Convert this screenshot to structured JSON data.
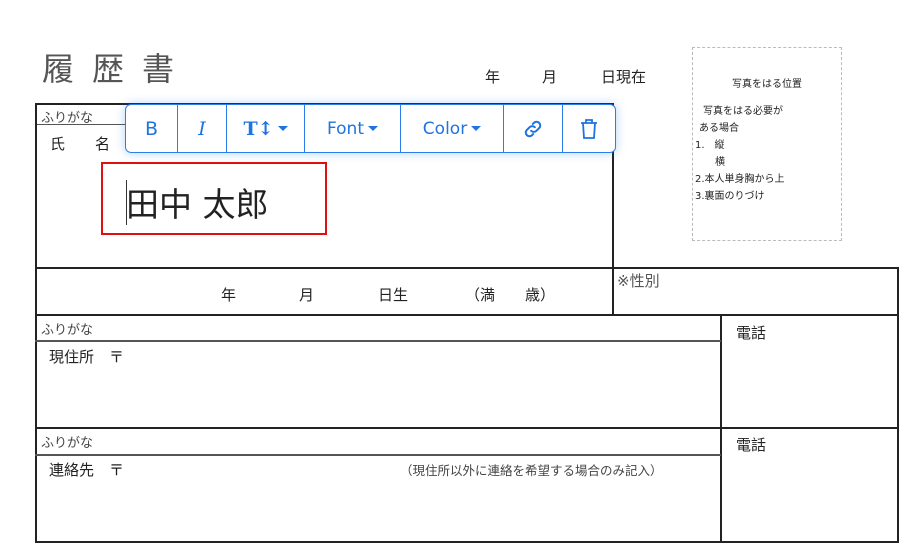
{
  "document": {
    "title": "履歴書",
    "date_line": {
      "year": "年",
      "month": "月",
      "day": "日現在"
    },
    "photo_box": {
      "heading": "写真をはる位置",
      "lines": [
        "写真をはる必要が",
        "ある場合",
        "1.　縦",
        "　　横",
        "2.本人単身胸から上",
        "3.裏面のりづけ"
      ]
    },
    "furigana_label": "ふりがな",
    "name_label": "氏　　名",
    "name_value": "田中 太郎",
    "birth": {
      "year": "年",
      "month": "月",
      "day": "日生",
      "age": "（満　　歳）"
    },
    "gender_label": "※性別",
    "address": {
      "furigana": "ふりがな",
      "label": "現住所　〒",
      "phone": "電話"
    },
    "contact": {
      "furigana": "ふりがな",
      "label": "連絡先　〒",
      "note": "（現住所以外に連絡を希望する場合のみ記入）",
      "phone": "電話"
    }
  },
  "toolbar": {
    "accent_color": "#2b7de9",
    "bold": "B",
    "italic": "I",
    "size": "T↕",
    "font": "Font",
    "color": "Color",
    "link_icon": "link-icon",
    "delete_icon": "trash-icon"
  },
  "selection_color": "#e01010"
}
